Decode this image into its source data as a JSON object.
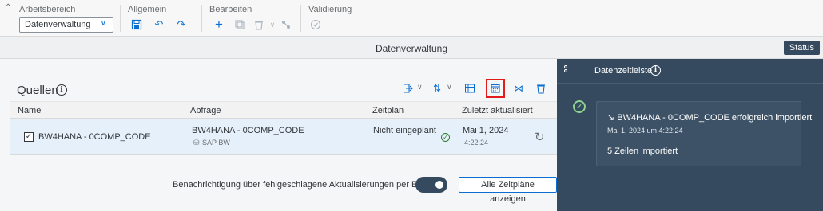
{
  "toolbar": {
    "groups": {
      "workspace": "Arbeitsbereich",
      "general": "Allgemein",
      "edit": "Bearbeiten",
      "validation": "Validierung"
    },
    "workspace_select": "Datenverwaltung"
  },
  "titlebar": {
    "title": "Datenverwaltung",
    "status_button": "Status"
  },
  "sources": {
    "title": "Quellen",
    "columns": [
      "Name",
      "Abfrage",
      "Zeitplan",
      "Zuletzt aktualisiert"
    ],
    "rows": [
      {
        "name": "BW4HANA - 0COMP_CODE",
        "query": "BW4HANA - 0COMP_CODE",
        "query_source": "SAP BW",
        "schedule": "Nicht eingeplant",
        "updated_date": "Mai 1, 2024",
        "updated_time": "4:22:24"
      }
    ]
  },
  "notification": {
    "label": "Benachrichtigung über fehlgeschlagene Aktualisierungen per E-Mail",
    "toggle_on": true,
    "show_all_button": "Alle Zeitpläne anzeigen"
  },
  "timeline": {
    "title": "Datenzeitleiste",
    "entry": {
      "title": "BW4HANA - 0COMP_CODE erfolgreich importiert",
      "date": "Mai 1, 2024 um 4:22:24",
      "body": "5 Zeilen importiert"
    }
  },
  "colors": {
    "accent": "#0a6ed1",
    "dark_panel": "#354a5f",
    "selection": "#e5f0fa",
    "highlight": "#e31b1b"
  }
}
